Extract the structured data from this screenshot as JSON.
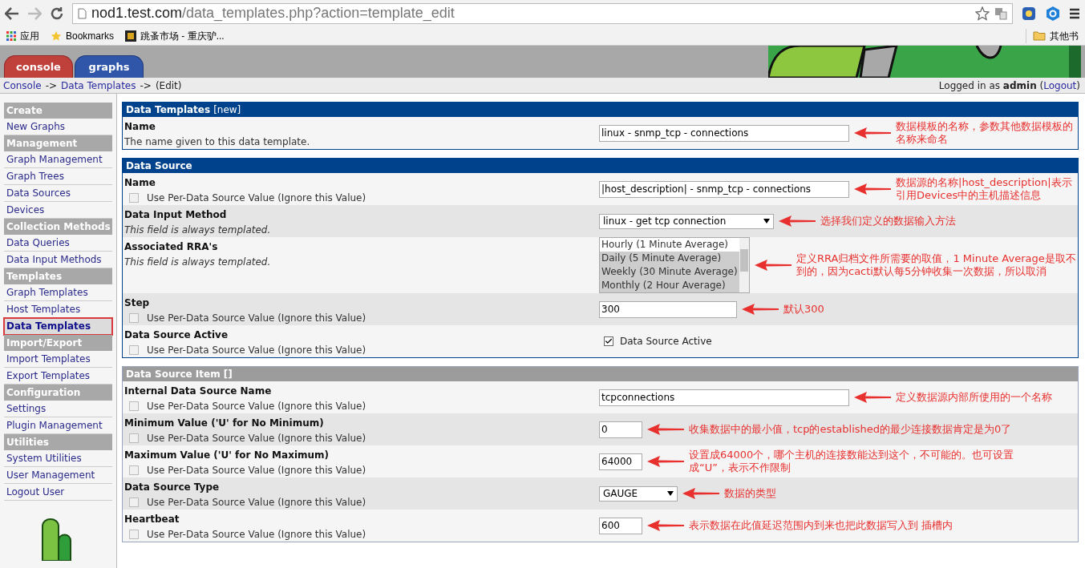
{
  "browser": {
    "url_host": "nod1.test.com",
    "url_path": "/data_templates.php?action=template_edit",
    "bookmarks": [
      "应用",
      "Bookmarks",
      "跳蚤市场 - 重庆驴..."
    ],
    "other_bookmarks": "其他书"
  },
  "tabs": [
    {
      "label": "console",
      "selected": true
    },
    {
      "label": "graphs",
      "selected": false
    }
  ],
  "breadcrumb": [
    {
      "kind": "link",
      "text": "Console"
    },
    {
      "kind": "text",
      "text": "->"
    },
    {
      "kind": "link",
      "text": "Data Templates"
    },
    {
      "kind": "text",
      "text": "->"
    },
    {
      "kind": "text",
      "text": "(Edit)"
    }
  ],
  "login": {
    "text": "Logged in as **admin** (",
    "link": "Logout",
    "end": ")"
  },
  "sidebar": [
    {
      "title": "Create",
      "items": [
        {
          "label": "New Graphs",
          "selected": false
        }
      ]
    },
    {
      "title": "Management",
      "items": [
        {
          "label": "Graph Management",
          "selected": false
        },
        {
          "label": "Graph Trees",
          "selected": false
        },
        {
          "label": "Data Sources",
          "selected": false
        },
        {
          "label": "Devices",
          "selected": false
        }
      ]
    },
    {
      "title": "Collection Methods",
      "items": [
        {
          "label": "Data Queries",
          "selected": false
        },
        {
          "label": "Data Input Methods",
          "selected": false
        }
      ]
    },
    {
      "title": "Templates",
      "items": [
        {
          "label": "Graph Templates",
          "selected": false
        },
        {
          "label": "Host Templates",
          "selected": false
        },
        {
          "label": "Data Templates",
          "selected": true
        }
      ]
    },
    {
      "title": "Import/Export",
      "items": [
        {
          "label": "Import Templates",
          "selected": false
        },
        {
          "label": "Export Templates",
          "selected": false
        }
      ]
    },
    {
      "title": "Configuration",
      "items": [
        {
          "label": "Settings",
          "selected": false
        },
        {
          "label": "Plugin Management",
          "selected": false
        }
      ]
    },
    {
      "title": "Utilities",
      "items": [
        {
          "label": "System Utilities",
          "selected": false
        },
        {
          "label": "User Management",
          "selected": false
        },
        {
          "label": "Logout User",
          "selected": false
        }
      ]
    }
  ],
  "panels": [
    {
      "title": "Data Templates",
      "suffix": "[new]",
      "rows": [
        {
          "label": "Name",
          "help": {
            "kind": "text",
            "text": "The name given to this data template."
          },
          "field": {
            "kind": "text",
            "value": "linux - snmp_tcp - connections"
          },
          "note": "数据模板的名称，参数其他数据模板的名称来命名"
        }
      ]
    },
    {
      "title": "Data Source",
      "rows": [
        {
          "label": "Name",
          "help": {
            "kind": "checkbox",
            "text": "Use Per-Data Source Value (Ignore this Value)",
            "checked": false
          },
          "field": {
            "kind": "text",
            "value": "|host_description| - snmp_tcp - connections"
          },
          "note": "数据源的名称|host_description|表示引用Devices中的主机描述信息"
        },
        {
          "label": "Data Input Method",
          "help": {
            "kind": "italic",
            "text": "This field is always templated."
          },
          "field": {
            "kind": "select",
            "value": "linux - get tcp connection"
          },
          "note": "选择我们定义的数据输入方法"
        },
        {
          "label": "Associated RRA's",
          "help": {
            "kind": "italic",
            "text": "This field is always templated."
          },
          "field": {
            "kind": "list",
            "options": [
              {
                "label": "Hourly (1 Minute Average)",
                "selected": false
              },
              {
                "label": "Daily (5 Minute Average)",
                "selected": true
              },
              {
                "label": "Weekly (30 Minute Average)",
                "selected": true
              },
              {
                "label": "Monthly (2 Hour Average)",
                "selected": true
              }
            ]
          },
          "note": "定义RRA归档文件所需要的取值，1 Minute Average是取不到的，因为cacti默认每5分钟收集一次数据，所以取消"
        },
        {
          "label": "Step",
          "help": {
            "kind": "checkbox",
            "text": "Use Per-Data Source Value (Ignore this Value)",
            "checked": false
          },
          "field": {
            "kind": "text",
            "value": "300"
          },
          "note": "默认300"
        },
        {
          "label": "Data Source Active",
          "help": {
            "kind": "checkbox",
            "text": "Use Per-Data Source Value (Ignore this Value)",
            "checked": false
          },
          "field": {
            "kind": "checkbox",
            "label": "Data Source Active",
            "checked": true
          }
        }
      ]
    },
    {
      "title": "Data Source Item []",
      "rows": [
        {
          "label": "Internal Data Source Name",
          "help": {
            "kind": "checkbox",
            "text": "Use Per-Data Source Value (Ignore this Value)",
            "checked": false
          },
          "field": {
            "kind": "text",
            "value": "tcpconnections"
          },
          "note": "定义数据源内部所使用的一个名称"
        },
        {
          "label": "Minimum Value ('U' for No Minimum)",
          "help": {
            "kind": "checkbox",
            "text": "Use Per-Data Source Value (Ignore this Value)",
            "checked": false
          },
          "field": {
            "kind": "text",
            "value": "0"
          },
          "note": "收集数据中的最小值，tcp的established的最少连接数据肯定是为0了"
        },
        {
          "label": "Maximum Value ('U' for No Maximum)",
          "help": {
            "kind": "checkbox",
            "text": "Use Per-Data Source Value (Ignore this Value)",
            "checked": false
          },
          "field": {
            "kind": "text",
            "value": "64000"
          },
          "note": "设置成64000个，哪个主机的连接数能达到这个，不可能的。也可设置成“U”，表示不作限制"
        },
        {
          "label": "Data Source Type",
          "help": {
            "kind": "checkbox",
            "text": "Use Per-Data Source Value (Ignore this Value)",
            "checked": false
          },
          "field": {
            "kind": "select",
            "value": "GAUGE"
          },
          "note": "数据的类型"
        },
        {
          "label": "Heartbeat",
          "help": {
            "kind": "checkbox",
            "text": "Use Per-Data Source Value (Ignore this Value)",
            "checked": false
          },
          "field": {
            "kind": "text",
            "value": "600"
          },
          "note": "表示数据在此值延迟范围内到来也把此数据写入到 插槽内"
        }
      ]
    }
  ]
}
